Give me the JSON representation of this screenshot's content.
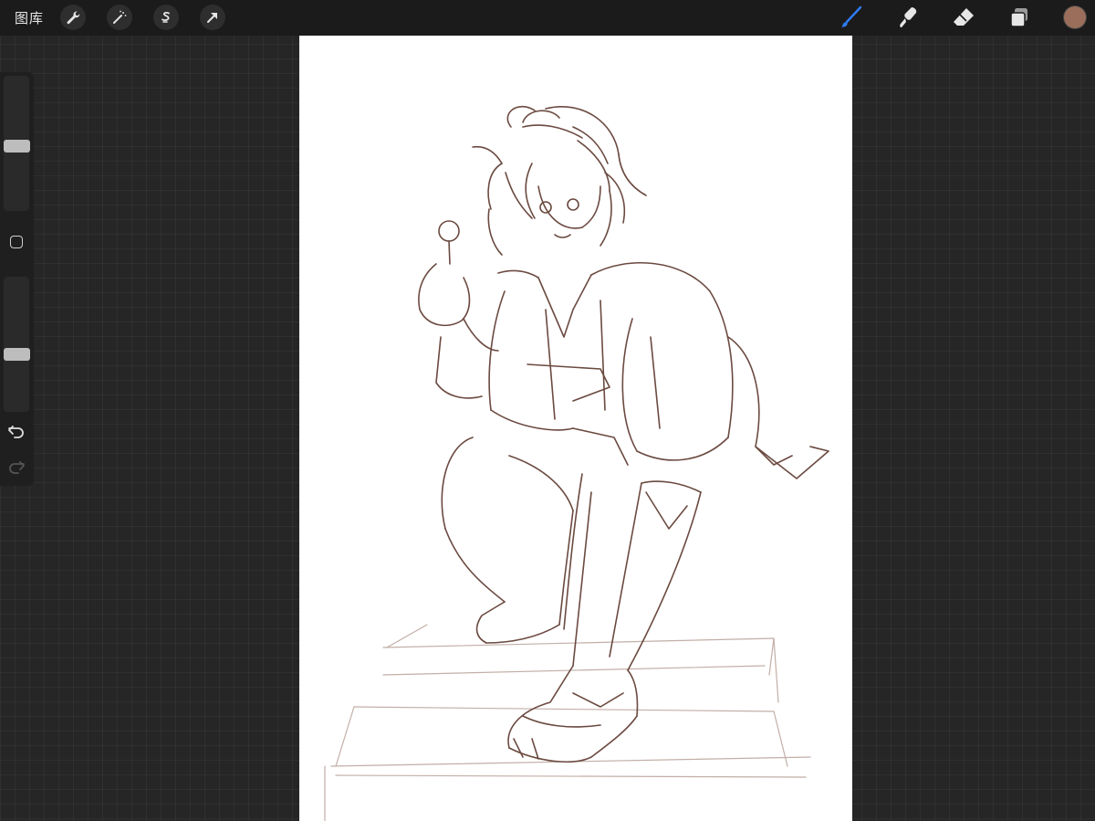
{
  "app": {
    "gallery_label": "图库"
  },
  "top_toolbar": {
    "left_tools": [
      "wrench-icon",
      "magic-wand-icon",
      "selection-icon",
      "transform-arrow-icon"
    ],
    "right_tools": [
      "brush-icon",
      "smudge-icon",
      "eraser-icon",
      "layers-icon"
    ],
    "active_tool": "brush-icon",
    "active_color": "#9a6e5a"
  },
  "sidebar": {
    "brush_size_level": 0.48,
    "opacity_level": 0.42,
    "buttons": [
      "modify-square-icon",
      "undo-icon",
      "redo-icon"
    ]
  },
  "canvas": {
    "background": "#ffffff",
    "sketch_color": "#6b4a40"
  }
}
